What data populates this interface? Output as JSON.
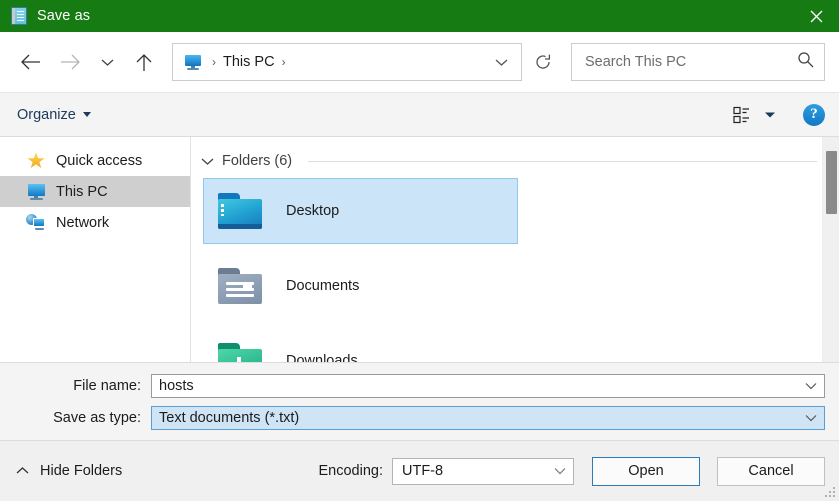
{
  "titlebar": {
    "title": "Save as",
    "app_icon": "notepad-icon",
    "close_label": "✕",
    "bg_color": "#177B14"
  },
  "nav": {
    "back_label": "Back",
    "forward_label": "Forward",
    "recent_label": "Recent locations",
    "up_label": "Up",
    "breadcrumb": {
      "icon": "this-pc-monitor-icon",
      "separator": "›",
      "path": "This PC",
      "trailing_separator": "›"
    },
    "refresh_label": "Refresh",
    "search": {
      "placeholder": "Search This PC",
      "value": "",
      "icon": "search-icon"
    }
  },
  "toolbar": {
    "organize_label": "Organize",
    "view_icon": "view-layout-icon",
    "view_dropdown_icon": "chevron-down-icon",
    "help_label": "?"
  },
  "sidebar": {
    "items": [
      {
        "label": "Quick access",
        "icon": "star-icon",
        "selected": false
      },
      {
        "label": "This PC",
        "icon": "monitor-icon",
        "selected": true
      },
      {
        "label": "Network",
        "icon": "network-icon",
        "selected": false
      }
    ]
  },
  "content": {
    "group_header": "Folders (6)",
    "group_collapse_icon": "chevron-down-icon",
    "folders": [
      {
        "label": "Desktop",
        "icon": "folder-desktop-icon",
        "selected": true
      },
      {
        "label": "Documents",
        "icon": "folder-documents-icon",
        "selected": false
      },
      {
        "label": "Downloads",
        "icon": "folder-downloads-icon",
        "selected": false
      }
    ],
    "scrollbar": "vertical-scrollbar"
  },
  "fields": {
    "file_name_label": "File name:",
    "file_name_value": "hosts",
    "save_as_type_label": "Save as type:",
    "save_as_type_value": "Text documents (*.txt)",
    "dropdown_icon": "chevron-down-icon"
  },
  "footer": {
    "hide_folders_label": "Hide Folders",
    "hide_folders_icon": "chevron-up-icon",
    "encoding_label": "Encoding:",
    "encoding_value": "UTF-8",
    "open_label": "Open",
    "cancel_label": "Cancel",
    "resize_grip": "resize-grip"
  },
  "colors": {
    "title_green": "#177B14",
    "selection_blue": "#cce4f7",
    "selection_border": "#90c8ef",
    "sidebar_selected": "#cfcfcf",
    "accent_blue": "#1277c4"
  }
}
